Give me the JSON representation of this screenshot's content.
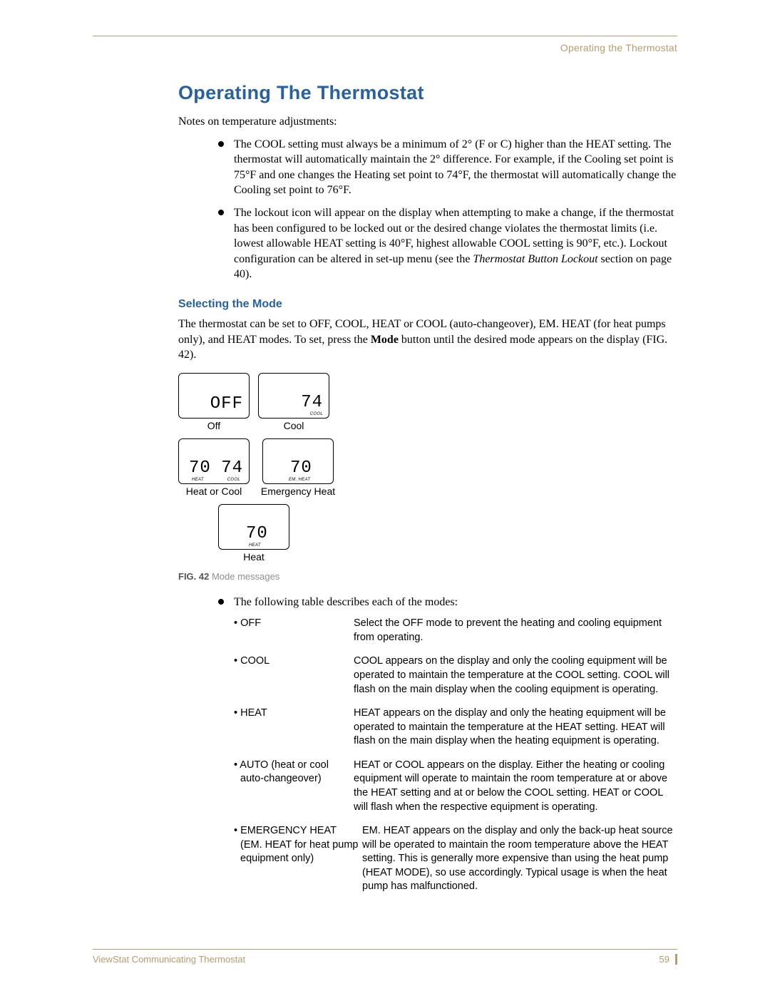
{
  "header": {
    "right": "Operating the Thermostat"
  },
  "title": "Operating The Thermostat",
  "intro": "Notes on temperature adjustments:",
  "notes": {
    "n1": "The COOL setting must always be a minimum of 2° (F or C) higher than the HEAT setting. The thermostat will automatically maintain the 2° difference. For example, if the Cooling set point is 75°F and one changes the Heating set point to 74°F, the thermostat will automatically change the Cooling set point to 76°F.",
    "n2a": "The lockout icon will appear on the display when attempting to make a change, if the thermostat has been configured to be locked out or the desired change violates the thermostat limits (i.e. lowest allowable HEAT setting is 40°F, highest allowable COOL setting is 90°F, etc.). Lockout configuration can be altered in set-up menu (see the ",
    "n2i": "Thermostat Button Lockout",
    "n2b": " section on page 40)."
  },
  "subheading": "Selecting the Mode",
  "mode_para_a": "The thermostat can be set to OFF, COOL, HEAT or COOL (auto-changeover), EM. HEAT (for heat pumps only), and HEAT modes. To set, press the ",
  "mode_para_bold": "Mode",
  "mode_para_b": " button until the desired mode appears on the display (FIG. 42).",
  "fig": {
    "off_big": "OFF",
    "off_label": "Off",
    "cool_big": "74",
    "cool_tag": "COOL",
    "cool_label": "Cool",
    "hc_big1": "70",
    "hc_big2": "74",
    "hc_tag1": "HEAT",
    "hc_tag2": "COOL",
    "hc_label": "Heat or Cool",
    "em_big": "70",
    "em_tag": "EM. HEAT",
    "em_label": "Emergency Heat",
    "heat_big": "70",
    "heat_tag": "HEAT",
    "heat_label": "Heat",
    "caption_b": "FIG. 42",
    "caption": "  Mode messages"
  },
  "table_intro": "The following table describes each of the modes:",
  "modes": {
    "r1t": "• OFF",
    "r1d": "Select the OFF mode to prevent the heating and cooling equipment from operating.",
    "r2t": "• COOL",
    "r2d": "COOL appears on the display and only the cooling equipment will be operated to maintain the temperature at the COOL setting. COOL will flash on the main display when the cooling equipment is operating.",
    "r3t": "• HEAT",
    "r3d": "HEAT appears on the display and only the heating equipment will be operated to maintain the temperature at the HEAT setting. HEAT will flash on the main display when the heating equipment is operating.",
    "r4t": "• AUTO (heat or cool",
    "r4t2": "auto-changeover)",
    "r4d": "HEAT or COOL appears on the display. Either the heating or cooling equipment will operate to maintain the room temperature at or above the HEAT setting and at or below the COOL setting. HEAT or COOL will flash when the respective equipment is operating.",
    "r5t": "• EMERGENCY HEAT",
    "r5t2": "(EM. HEAT for heat pump",
    "r5t3": "equipment only)",
    "r5d": "EM. HEAT appears on the display and only the back-up heat source will be operated to maintain the room temperature above the HEAT setting. This is generally more expensive than using the heat pump (HEAT MODE), so use accordingly. Typical usage is when the heat pump has malfunctioned."
  },
  "footer": {
    "left": "ViewStat Communicating Thermostat",
    "right": "59"
  }
}
